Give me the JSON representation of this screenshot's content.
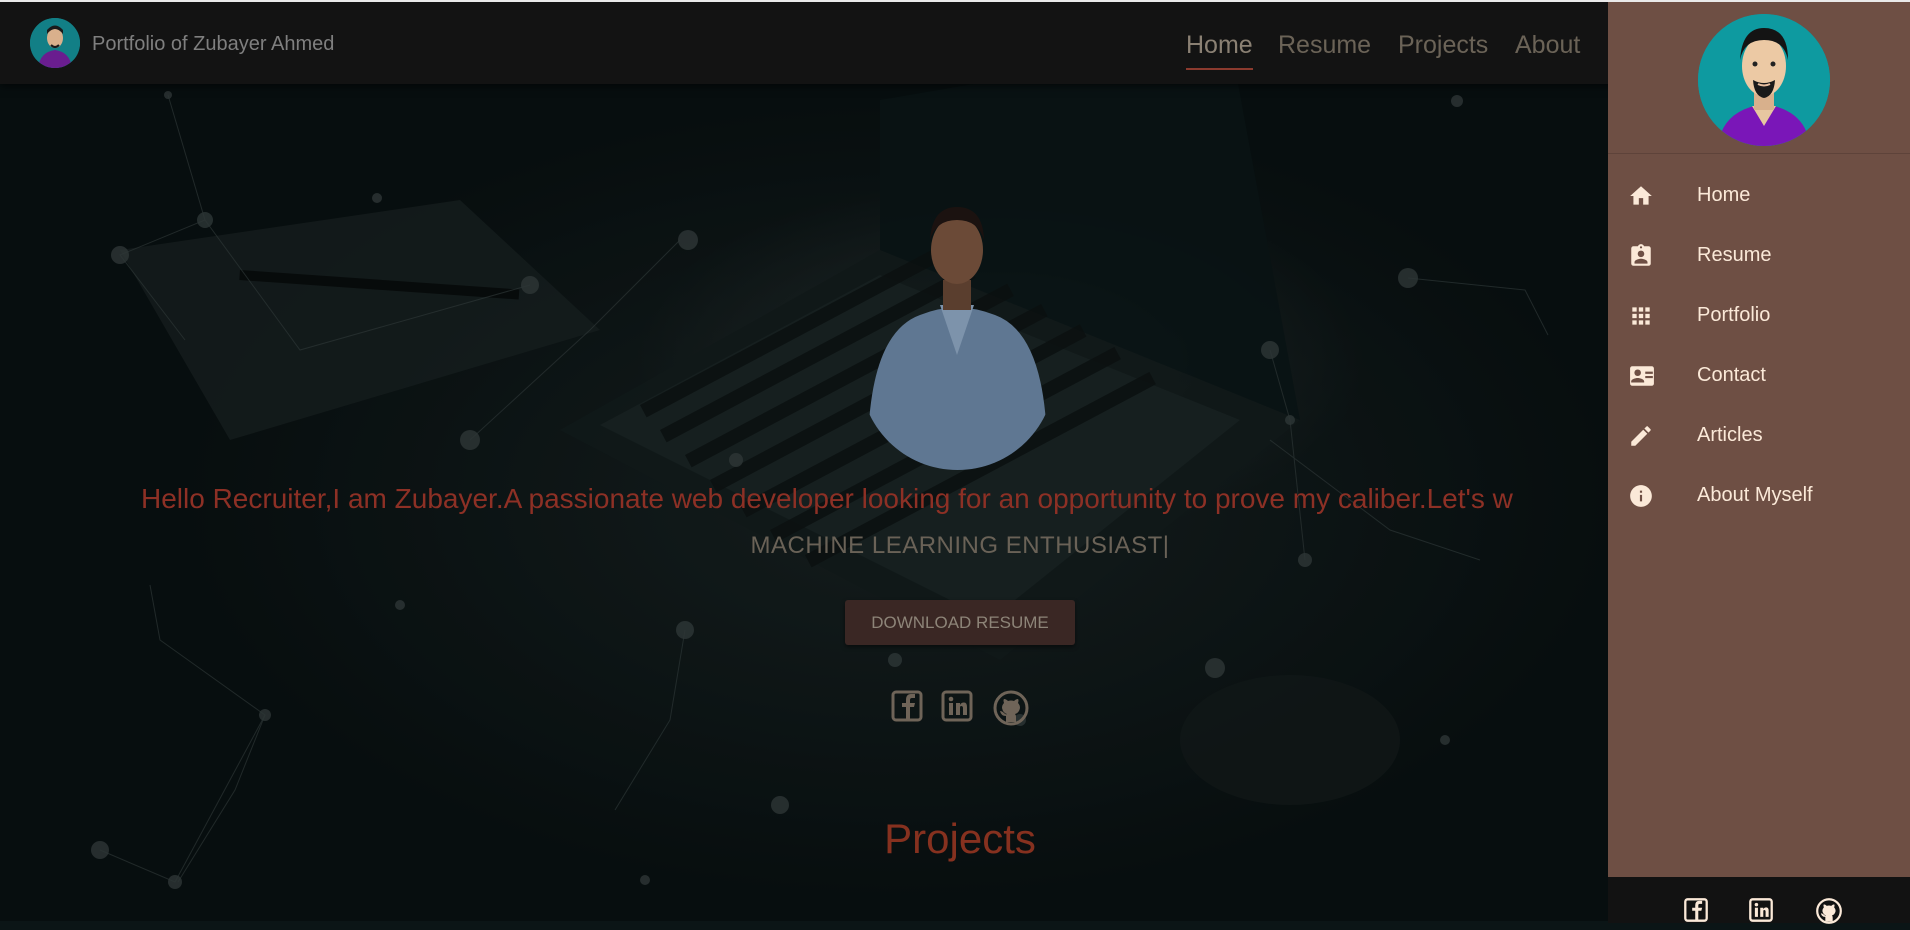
{
  "brand": {
    "title": "Portfolio of Zubayer Ahmed"
  },
  "nav": {
    "items": [
      {
        "label": "Home",
        "active": true
      },
      {
        "label": "Resume"
      },
      {
        "label": "Projects"
      },
      {
        "label": "About"
      }
    ]
  },
  "hero": {
    "greeting": "Hello Recruiter,I am Zubayer.A passionate web developer looking for an opportunity to prove my caliber.Let's w",
    "role": "MACHINE LEARNING ENTHUSIAST|",
    "download_label": "DOWNLOAD RESUME",
    "socials": [
      "facebook-icon",
      "linkedin-icon",
      "github-icon"
    ]
  },
  "sections": {
    "projects_title": "Projects"
  },
  "drawer": {
    "items": [
      {
        "label": "Home",
        "icon": "home-icon"
      },
      {
        "label": "Resume",
        "icon": "badge-icon"
      },
      {
        "label": "Portfolio",
        "icon": "apps-grid-icon"
      },
      {
        "label": "Contact",
        "icon": "contact-card-icon"
      },
      {
        "label": "Articles",
        "icon": "pencil-icon"
      },
      {
        "label": "About Myself",
        "icon": "info-icon"
      }
    ],
    "footer_icons": [
      "facebook-icon",
      "linkedin-icon",
      "github-icon"
    ]
  },
  "colors": {
    "drawer_bg": "#6e4f44",
    "accent_red": "#8d3025",
    "navbar_bg": "#131313",
    "drawer_text": "#fbe9d8"
  }
}
